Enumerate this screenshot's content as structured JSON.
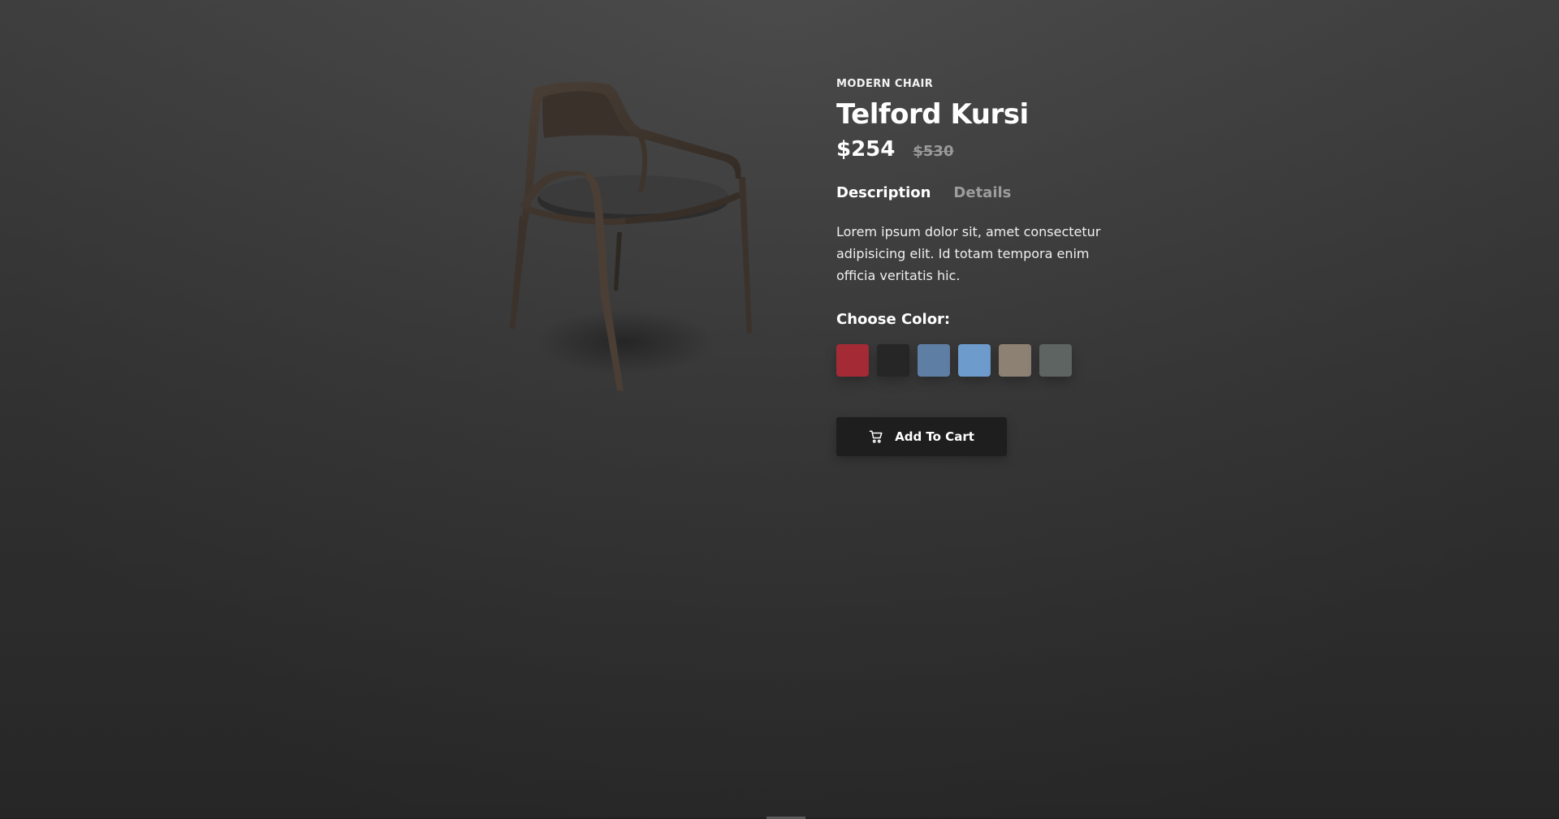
{
  "product": {
    "category": "MODERN CHAIR",
    "name": "Telford Kursi",
    "price": "$254",
    "old_price": "$530",
    "image_icon": "chair-product-image"
  },
  "tabs": [
    {
      "label": "Description",
      "active": true
    },
    {
      "label": "Details",
      "active": false
    }
  ],
  "description": "Lorem ipsum dolor sit, amet consectetur adipisicing elit. Id totam tempora enim officia veritatis hic.",
  "colors": {
    "label": "Choose Color:",
    "swatches": [
      {
        "name": "red",
        "hex": "#a42a36"
      },
      {
        "name": "black",
        "hex": "#262626"
      },
      {
        "name": "denim",
        "hex": "#5f7ea4"
      },
      {
        "name": "light-blue",
        "hex": "#6d9bcc"
      },
      {
        "name": "beige",
        "hex": "#8d8173"
      },
      {
        "name": "grey",
        "hex": "#5d6461"
      }
    ]
  },
  "cart_button": {
    "label": "Add To Cart",
    "icon": "cart-icon"
  }
}
